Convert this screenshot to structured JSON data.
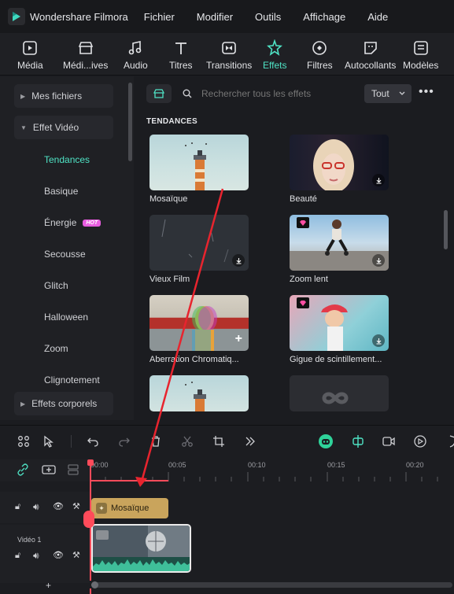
{
  "app": {
    "name": "Wondershare Filmora"
  },
  "menu": [
    "Fichier",
    "Modifier",
    "Outils",
    "Affichage",
    "Aide"
  ],
  "toolbar": {
    "tabs": [
      {
        "label": "Média",
        "icon": "media-icon"
      },
      {
        "label": "Médi...ives",
        "icon": "stock-media-icon"
      },
      {
        "label": "Audio",
        "icon": "music-icon"
      },
      {
        "label": "Titres",
        "icon": "text-icon"
      },
      {
        "label": "Transitions",
        "icon": "transition-icon"
      },
      {
        "label": "Effets",
        "icon": "effects-icon"
      },
      {
        "label": "Filtres",
        "icon": "filter-icon"
      },
      {
        "label": "Autocollants",
        "icon": "sticker-icon"
      },
      {
        "label": "Modèles",
        "icon": "template-icon"
      }
    ],
    "active": "Effets"
  },
  "sidebar": {
    "groups": [
      "Mes fichiers",
      "Effet Vidéo",
      "Effets corporels"
    ],
    "items": [
      "Tendances",
      "Basique",
      "Énergie",
      "Secousse",
      "Glitch",
      "Halloween",
      "Zoom",
      "Clignotement"
    ],
    "hot_badge": "HOT"
  },
  "search": {
    "placeholder": "Rechercher tous les effets",
    "filter": "Tout"
  },
  "section_title": "TENDANCES",
  "effects": [
    "Mosaïque",
    "Beauté",
    "Vieux Film",
    "Zoom lent",
    "Aberration Chromatiq...",
    "Gigue de scintillement..."
  ],
  "timeline": {
    "ticks": [
      "00:00",
      "00:05",
      "00:10",
      "00:15",
      "00:20"
    ],
    "effect_clip": "Mosaïque",
    "track_label": "Vidéo 1"
  },
  "colors": {
    "accent": "#4fe3c5",
    "playhead": "#ff4b5a",
    "effect_clip": "#c9a45c",
    "annotation_arrow": "#e8242e"
  }
}
